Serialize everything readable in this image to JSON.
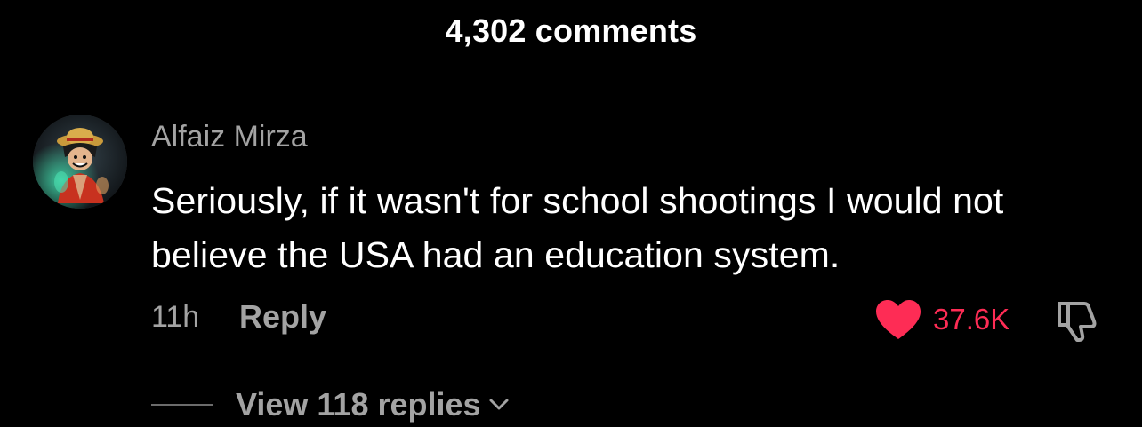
{
  "header": {
    "comments_count": "4,302 comments"
  },
  "comment": {
    "avatar_icon": "user-avatar-anime-character",
    "username": "Alfaiz Mirza",
    "text": "Seriously, if it wasn't for school shootings I would not believe the USA had an education system.",
    "timestamp": "11h",
    "reply_label": "Reply",
    "like_icon": "heart-icon",
    "like_count": "37.6K",
    "like_color": "#fe2c55",
    "dislike_icon": "thumbs-down-icon",
    "view_replies_label": "View 118 replies",
    "chevron_icon": "chevron-down-icon"
  },
  "colors": {
    "background": "#000000",
    "primary_text": "#ffffff",
    "secondary_text": "#a3a3a3",
    "accent": "#fe2c55"
  }
}
